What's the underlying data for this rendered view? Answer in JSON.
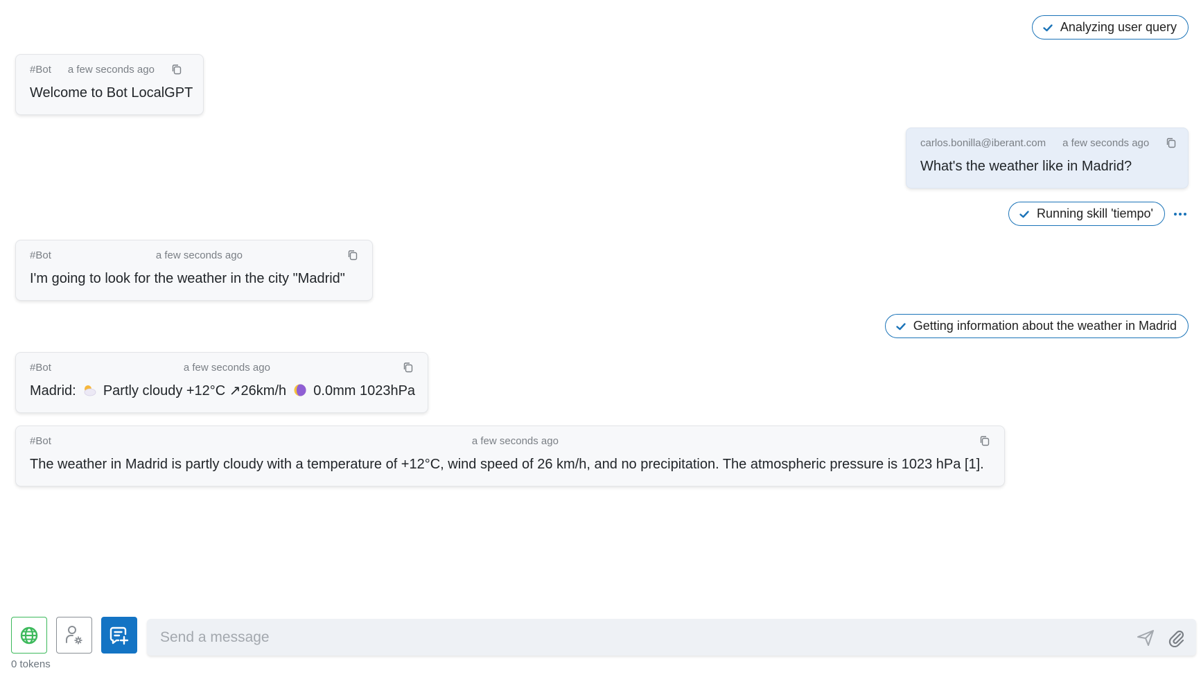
{
  "colors": {
    "accent": "#1474c4",
    "pill_border": "#1a73b8",
    "web_green": "#3cb95b",
    "bot_bg": "#f7f8fa",
    "user_bg": "#e7eef8"
  },
  "status_pills": [
    {
      "label": "Analyzing user query",
      "icon": "check-icon"
    },
    {
      "label": "Running skill 'tiempo'",
      "icon": "check-icon",
      "has_more": true
    },
    {
      "label": "Getting information about the weather in Madrid",
      "icon": "check-icon"
    }
  ],
  "messages": [
    {
      "role": "bot",
      "author": "#Bot",
      "timestamp": "a few seconds ago",
      "text": "Welcome to Bot LocalGPT"
    },
    {
      "role": "user",
      "author": "carlos.bonilla@iberant.com",
      "timestamp": "a few seconds ago",
      "text": "What's the weather like in Madrid?"
    },
    {
      "role": "bot",
      "author": "#Bot",
      "timestamp": "a few seconds ago",
      "text": "I'm going to look for the weather in the city \"Madrid\""
    },
    {
      "role": "bot",
      "author": "#Bot",
      "timestamp": "a few seconds ago",
      "parts": {
        "city": "Madrid:",
        "condition_icon": "sun-behind-cloud-emoji",
        "condition": "Partly cloudy +12°C ↗26km/h",
        "moon_icon": "moon-phase-emoji",
        "rest": "0.0mm 1023hPa"
      }
    },
    {
      "role": "bot",
      "author": "#Bot",
      "timestamp": "a few seconds ago",
      "text": "The weather in Madrid is partly cloudy with a temperature of +12°C, wind speed of 26 km/h, and no precipitation. The atmospheric pressure is 1023 hPa [1]."
    }
  ],
  "copy_icon": "copy-icon",
  "footer": {
    "buttons": [
      {
        "name": "web-search",
        "icon": "globe-icon"
      },
      {
        "name": "persona-settings",
        "icon": "user-gear-icon"
      },
      {
        "name": "new-chat",
        "icon": "chat-plus-icon"
      }
    ],
    "tokens_label": "0 tokens",
    "composer": {
      "placeholder": "Send a message",
      "value": "",
      "send_icon": "send-icon",
      "attach_icon": "paperclip-icon"
    }
  }
}
